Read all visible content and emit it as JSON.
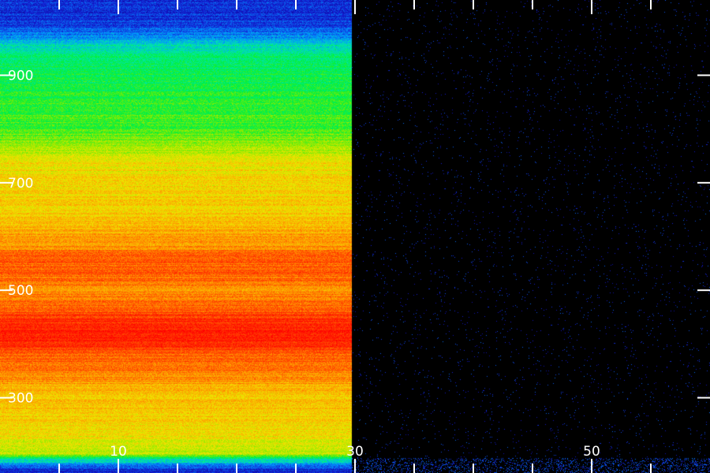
{
  "chart_data": {
    "type": "heatmap",
    "title": "",
    "xlabel": "",
    "ylabel": "",
    "x_ticks": [
      {
        "value": 10,
        "label": "10"
      },
      {
        "value": 30,
        "label": "30"
      },
      {
        "value": 50,
        "label": "50"
      }
    ],
    "x_minor_step": 5,
    "y_ticks": [
      {
        "value": 300,
        "label": "300"
      },
      {
        "value": 500,
        "label": "500"
      },
      {
        "value": 700,
        "label": "700"
      },
      {
        "value": 900,
        "label": "900"
      }
    ],
    "xlim": [
      0,
      60
    ],
    "ylim": [
      160,
      1040
    ],
    "data_x_range": [
      0,
      29.7
    ],
    "colormap": "rainbow (blue → cyan → green → yellow → orange → red)",
    "intensity_scale": [
      0,
      1
    ],
    "intensity_profile": [
      {
        "y": 1040,
        "value": 0.12
      },
      {
        "y": 1000,
        "value": 0.14
      },
      {
        "y": 975,
        "value": 0.22
      },
      {
        "y": 955,
        "value": 0.35
      },
      {
        "y": 935,
        "value": 0.4
      },
      {
        "y": 900,
        "value": 0.43
      },
      {
        "y": 850,
        "value": 0.47
      },
      {
        "y": 800,
        "value": 0.5
      },
      {
        "y": 775,
        "value": 0.55
      },
      {
        "y": 760,
        "value": 0.6
      },
      {
        "y": 740,
        "value": 0.66
      },
      {
        "y": 700,
        "value": 0.68
      },
      {
        "y": 650,
        "value": 0.7
      },
      {
        "y": 620,
        "value": 0.73
      },
      {
        "y": 585,
        "value": 0.78
      },
      {
        "y": 555,
        "value": 0.86
      },
      {
        "y": 520,
        "value": 0.84
      },
      {
        "y": 500,
        "value": 0.79
      },
      {
        "y": 480,
        "value": 0.83
      },
      {
        "y": 440,
        "value": 0.93
      },
      {
        "y": 415,
        "value": 0.95
      },
      {
        "y": 380,
        "value": 0.86
      },
      {
        "y": 345,
        "value": 0.8
      },
      {
        "y": 305,
        "value": 0.72
      },
      {
        "y": 265,
        "value": 0.7
      },
      {
        "y": 230,
        "value": 0.66
      },
      {
        "y": 195,
        "value": 0.6
      },
      {
        "y": 190,
        "value": 0.42
      },
      {
        "y": 170,
        "value": 0.14
      },
      {
        "y": 160,
        "value": 0.1
      }
    ],
    "background_region": {
      "x_from": 29.7,
      "x_to": 60,
      "value": 0.0
    },
    "colors": {
      "background": "#000000",
      "axis": "#ffffff",
      "tick_label": "#ffffff"
    }
  }
}
